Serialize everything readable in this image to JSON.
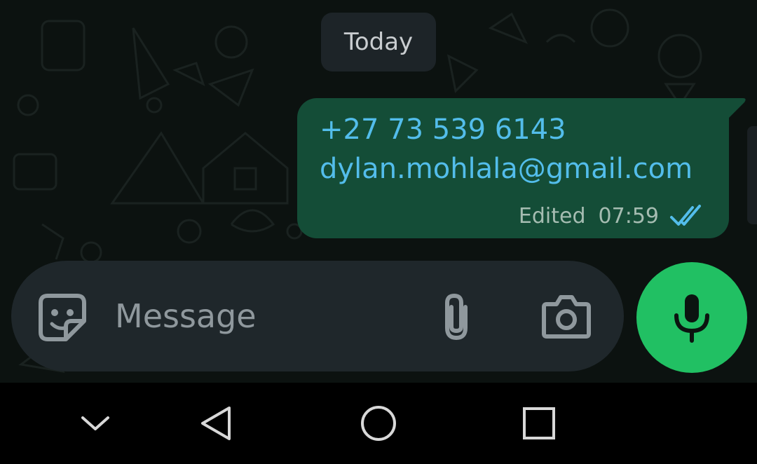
{
  "chat": {
    "day_label": "Today",
    "message": {
      "line1": "+27 73 539 6143",
      "line2": "dylan.mohlala@gmail.com",
      "edited_label": "Edited",
      "time": "07:59",
      "status_icon": "double-check-read-icon"
    }
  },
  "composer": {
    "placeholder": "Message",
    "left_icon": "sticker-icon",
    "attach_icon": "paperclip-icon",
    "camera_icon": "camera-icon",
    "send_icon": "microphone-icon"
  },
  "navbar": {
    "icons": [
      "chevron-down-icon",
      "back-triangle-icon",
      "home-circle-icon",
      "recents-square-icon"
    ]
  },
  "colors": {
    "chat_background": "#0c1210",
    "bubble_outgoing": "#144d37",
    "link_text": "#53bdeb",
    "meta_text": "#a5bcb1",
    "composer_background": "#1f272b",
    "accent_green": "#21c063",
    "read_ticks": "#53bdeb"
  }
}
